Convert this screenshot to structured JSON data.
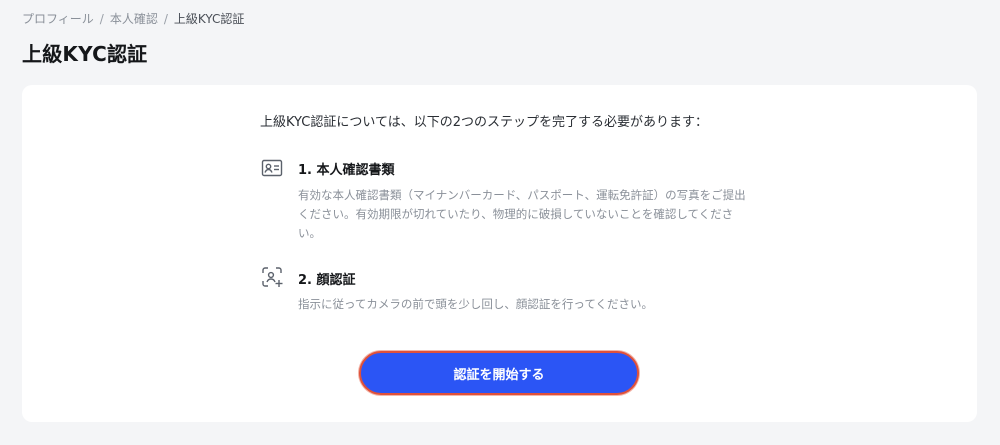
{
  "breadcrumb": {
    "items": [
      "プロフィール",
      "本人確認",
      "上級KYC認証"
    ],
    "separator": "/"
  },
  "page": {
    "title": "上級KYC認証"
  },
  "card": {
    "intro": "上級KYC認証については、以下の2つのステップを完了する必要があります：",
    "steps": [
      {
        "icon": "id-card-icon",
        "title": "1. 本人確認書類",
        "desc_line1": "有効な本人確認書類（マイナンバーカード、パスポート、運転免許証）の写真をご提出",
        "desc_line2": "ください。有効期限が切れていたり、物理的に破損していないことを確認してくださ",
        "desc_line3": "い。"
      },
      {
        "icon": "face-scan-icon",
        "title": "2. 顔認証",
        "desc_line1": "指示に従ってカメラの前で頭を少し回し、顔認証を行ってください。"
      }
    ],
    "start_button": "認証を開始する"
  },
  "colors": {
    "accent": "#2b55f5",
    "focus_ring": "#e0513a",
    "background": "#f4f5f7"
  }
}
